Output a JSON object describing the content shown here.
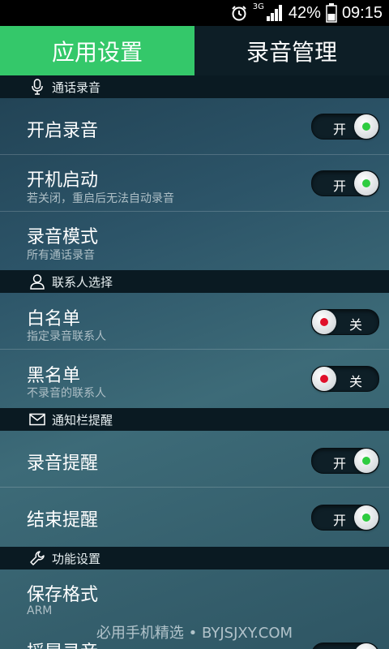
{
  "status_bar": {
    "network": "3G",
    "battery": "42%",
    "time": "09:15"
  },
  "tabs": [
    {
      "label": "应用设置",
      "active": true
    },
    {
      "label": "录音管理",
      "active": false
    }
  ],
  "sections": {
    "call_recording": {
      "header": "通话录音",
      "icon": "microphone-icon",
      "rows": [
        {
          "title": "开启录音",
          "toggle": "开",
          "state": "on"
        },
        {
          "title": "开机启动",
          "subtitle": "若关闭，重启后无法自动录音",
          "toggle": "开",
          "state": "on"
        },
        {
          "title": "录音模式",
          "subtitle": "所有通话录音"
        }
      ]
    },
    "contacts": {
      "header": "联系人选择",
      "icon": "person-icon",
      "rows": [
        {
          "title": "白名单",
          "subtitle": "指定录音联系人",
          "toggle": "关",
          "state": "off"
        },
        {
          "title": "黑名单",
          "subtitle": "不录音的联系人",
          "toggle": "关",
          "state": "off"
        }
      ]
    },
    "notification": {
      "header": "通知栏提醒",
      "icon": "envelope-icon",
      "rows": [
        {
          "title": "录音提醒",
          "toggle": "开",
          "state": "on"
        },
        {
          "title": "结束提醒",
          "toggle": "开",
          "state": "on"
        }
      ]
    },
    "functions": {
      "header": "功能设置",
      "icon": "wrench-icon",
      "rows": [
        {
          "title": "保存格式",
          "subtitle": "ARM"
        },
        {
          "title": "摇晃录音"
        }
      ]
    }
  },
  "watermark": "必用手机精选 • BYJSJXY.COM",
  "colors": {
    "accent": "#34c86a",
    "on_dot": "#2ecc40",
    "off_dot": "#e0102a"
  }
}
